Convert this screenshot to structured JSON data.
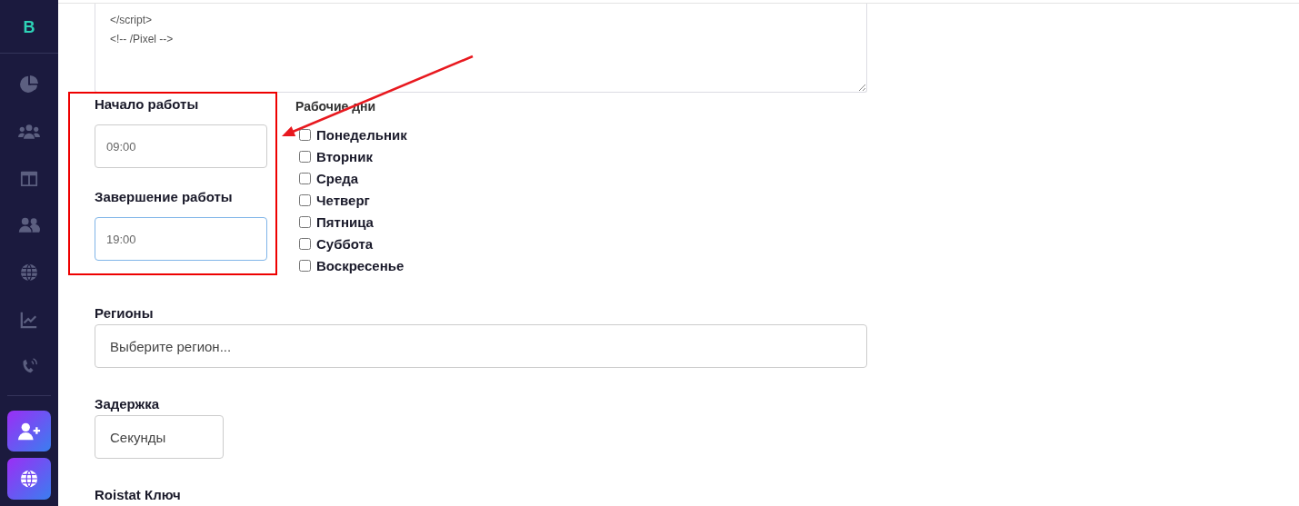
{
  "sidebar": {
    "logo": "B"
  },
  "code_field": {
    "lines": [
      "</script>",
      "<!-- /Pixel -->"
    ]
  },
  "work_start": {
    "label": "Начало работы",
    "value": "09:00",
    "focused": false
  },
  "work_end": {
    "label": "Завершение работы",
    "value": "19:00",
    "focused": true
  },
  "work_days": {
    "label": "Рабочие дни",
    "days": [
      {
        "label": "Понедельник",
        "checked": false
      },
      {
        "label": "Вторник",
        "checked": false
      },
      {
        "label": "Среда",
        "checked": false
      },
      {
        "label": "Четверг",
        "checked": false
      },
      {
        "label": "Пятница",
        "checked": false
      },
      {
        "label": "Суббота",
        "checked": false
      },
      {
        "label": "Воскресенье",
        "checked": false
      }
    ]
  },
  "regions": {
    "label": "Регионы",
    "placeholder": "Выберите регион..."
  },
  "delay": {
    "label": "Задержка",
    "placeholder": "Секунды"
  },
  "roistat": {
    "label": "Roistat Ключ"
  }
}
